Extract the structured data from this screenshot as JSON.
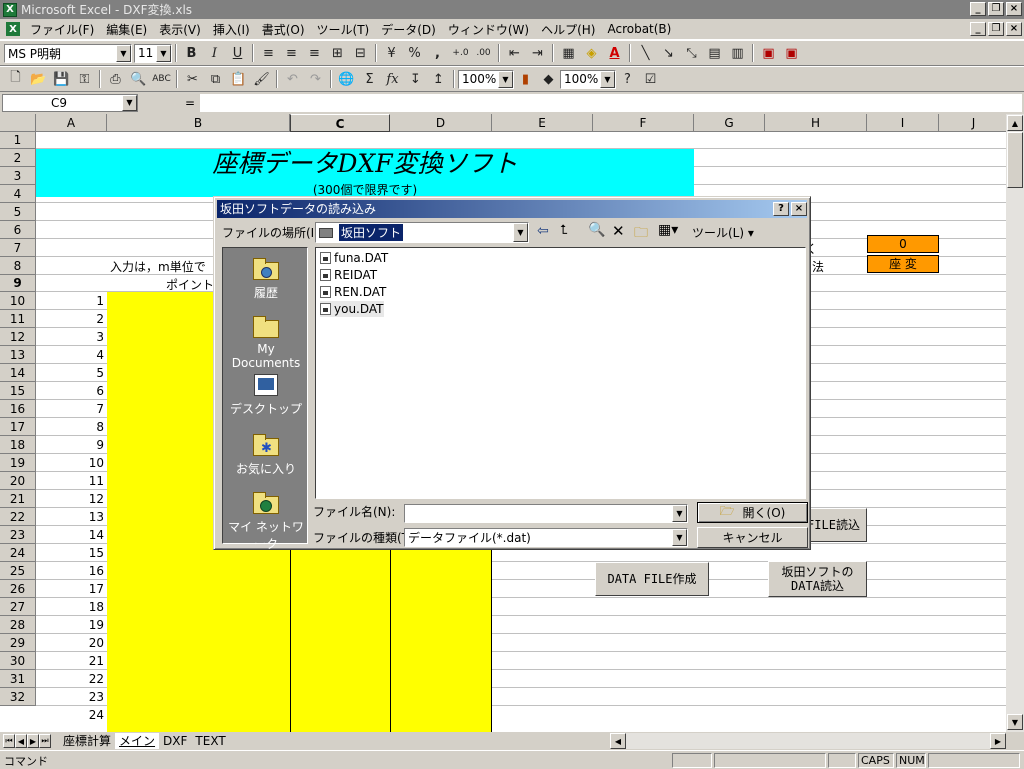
{
  "window": {
    "title": "Microsoft Excel - DXF変換.xls",
    "app_icon": "X"
  },
  "menu": [
    "ファイル(F)",
    "編集(E)",
    "表示(V)",
    "挿入(I)",
    "書式(O)",
    "ツール(T)",
    "データ(D)",
    "ウィンドウ(W)",
    "ヘルプ(H)",
    "Acrobat(B)"
  ],
  "format_toolbar": {
    "font": "MS P明朝",
    "size": "11",
    "bold": "B",
    "italic": "I",
    "underline": "U",
    "percent": "%",
    "comma": ","
  },
  "standard_toolbar": {
    "zoom1": "100%",
    "zoom2": "100%",
    "sum": "Σ",
    "fx": "fx"
  },
  "formula_bar": {
    "cell_ref": "C9",
    "equals": "=",
    "value": ""
  },
  "columns": [
    "A",
    "B",
    "C",
    "D",
    "E",
    "F",
    "G",
    "H",
    "I",
    "J"
  ],
  "rows": [
    "1",
    "2",
    "3",
    "4",
    "5",
    "6",
    "7",
    "8",
    "9",
    "10",
    "11",
    "12",
    "13",
    "14",
    "15",
    "16",
    "17",
    "18",
    "19",
    "20",
    "21",
    "22",
    "23",
    "24",
    "25",
    "26",
    "27",
    "28",
    "29",
    "30",
    "31",
    "32"
  ],
  "sheet": {
    "title": "座標データDXF変換ソフト",
    "subtitle": "(300個で限界です)",
    "input_note": "入力は，m単位で",
    "point_header": "ポイント",
    "point_numbers": [
      "1",
      "2",
      "3",
      "4",
      "5",
      "6",
      "7",
      "8",
      "9",
      "10",
      "11",
      "12",
      "13",
      "14",
      "15",
      "16",
      "17",
      "18",
      "19",
      "20",
      "21",
      "22",
      "23",
      "24"
    ],
    "h6_fragment": "く",
    "h7_fragment": "法",
    "counter_value": "0",
    "zahen_label": "座 変",
    "yellow": "#ffff00",
    "cyan": "#00ffff",
    "orange": "#ff9900"
  },
  "sheet_buttons": {
    "file_read": "FILE読込",
    "data_create": "DATA FILE作成",
    "sakata_read_line1": "坂田ソフトの",
    "sakata_read_line2": "DATA読込"
  },
  "sheet_tabs": [
    "座標計算",
    "メイン",
    "DXF",
    "TEXT"
  ],
  "status": {
    "mode": "コマンド",
    "caps": "CAPS",
    "num": "NUM"
  },
  "dialog": {
    "title": "坂田ソフトデータの読み込み",
    "help": "?",
    "close": "×",
    "look_in_label": "ファイルの場所(I):",
    "look_in_value": "坂田ソフト",
    "tools_label": "ツール(L)",
    "places": [
      {
        "label": "履歴",
        "icon": "history-icon"
      },
      {
        "label": "My Documents",
        "icon": "folder-icon"
      },
      {
        "label": "デスクトップ",
        "icon": "desktop-icon"
      },
      {
        "label": "お気に入り",
        "icon": "favorites-icon"
      },
      {
        "label": "マイ ネットワーク",
        "icon": "network-icon"
      }
    ],
    "files": [
      "funa.DAT",
      "REIDAT",
      "REN.DAT",
      "you.DAT"
    ],
    "filename_label": "ファイル名(N):",
    "filename_value": "",
    "filetype_label": "ファイルの種類(T):",
    "filetype_value": "データファイル(*.dat)",
    "open_label": "開く(O)",
    "cancel_label": "キャンセル"
  }
}
